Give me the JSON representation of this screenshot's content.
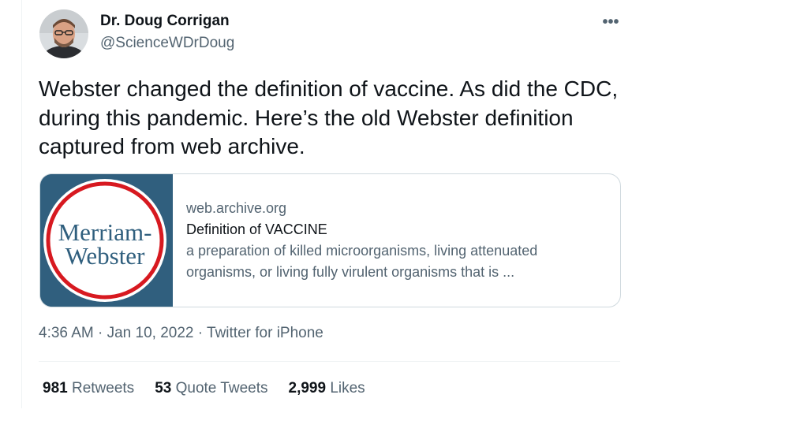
{
  "author": {
    "name": "Dr. Doug Corrigan",
    "handle": "@ScienceWDrDoug"
  },
  "more_menu": {
    "icon": "more-horizontal-icon",
    "glyph": "•••"
  },
  "tweet": {
    "text": "Webster changed the definition of vaccine. As did the CDC, during this pandemic. Here’s the old Webster definition captured from web archive."
  },
  "link_card": {
    "thumbnail_logo_text": [
      "Merriam-",
      "Webster"
    ],
    "domain": "web.archive.org",
    "title": "Definition of VACCINE",
    "description": "a preparation of killed microorganisms, living attenuated organisms, or living fully virulent organisms that is ..."
  },
  "meta": {
    "time": "4:36 AM",
    "separator": "·",
    "date": "Jan 10, 2022",
    "source": "Twitter for iPhone"
  },
  "stats": {
    "retweets": {
      "count": "981",
      "label": "Retweets"
    },
    "quote_tweets": {
      "count": "53",
      "label": "Quote Tweets"
    },
    "likes": {
      "count": "2,999",
      "label": "Likes"
    }
  },
  "colors": {
    "text_primary": "#0f1419",
    "text_secondary": "#536471",
    "border": "#cfd9de",
    "mw_blue": "#305f7e",
    "mw_red": "#d71920"
  }
}
